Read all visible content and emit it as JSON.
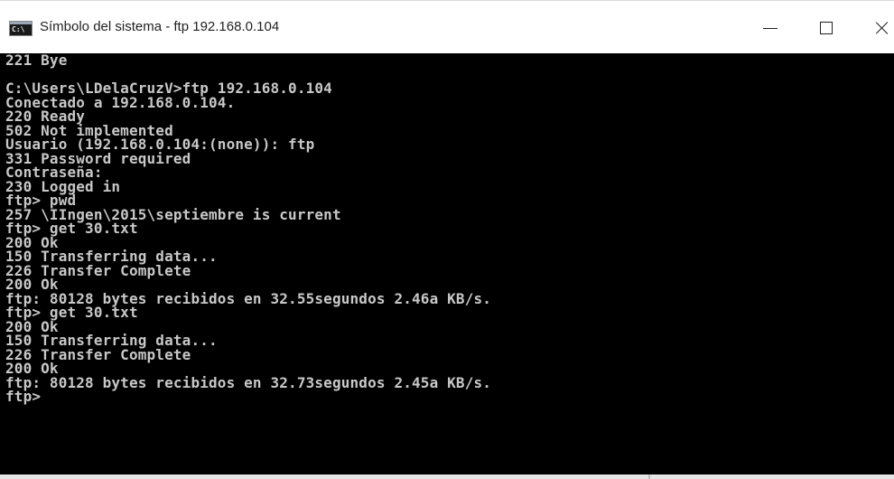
{
  "window": {
    "title": "Símbolo del sistema - ftp  192.168.0.104",
    "icon_label": "C:\\",
    "icon": "cmd-icon",
    "controls": {
      "minimize_icon": "minimize-icon",
      "maximize_icon": "maximize-icon",
      "close_icon": "close-icon"
    }
  },
  "console": {
    "background": "#000000",
    "foreground": "#c8c8c8",
    "lines": [
      "221 Bye",
      "",
      "C:\\Users\\LDelaCruzV>ftp 192.168.0.104",
      "Conectado a 192.168.0.104.",
      "220 Ready",
      "502 Not implemented",
      "Usuario (192.168.0.104:(none)): ftp",
      "331 Password required",
      "Contraseña:",
      "230 Logged in",
      "ftp> pwd",
      "257 \\IIngen\\2015\\septiembre is current",
      "ftp> get 30.txt",
      "200 Ok",
      "150 Transferring data...",
      "226 Transfer Complete",
      "200 Ok",
      "ftp: 80128 bytes recibidos en 32.55segundos 2.46a KB/s.",
      "ftp> get 30.txt",
      "200 Ok",
      "150 Transferring data...",
      "226 Transfer Complete",
      "200 Ok",
      "ftp: 80128 bytes recibidos en 32.73segundos 2.45a KB/s.",
      "ftp>"
    ]
  }
}
